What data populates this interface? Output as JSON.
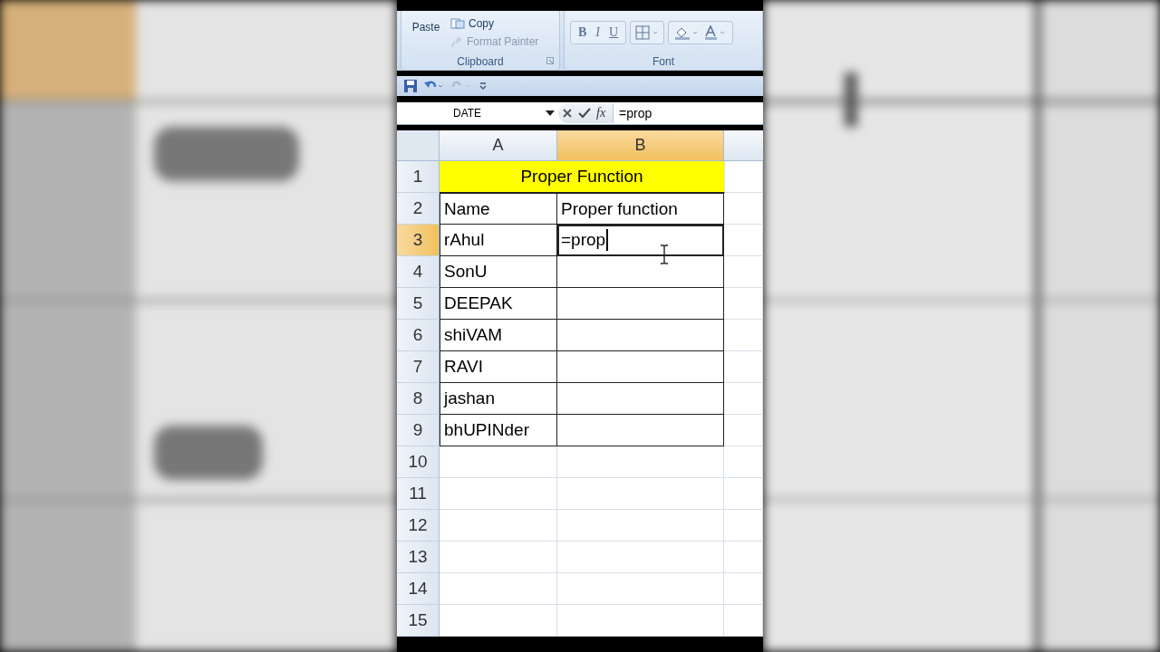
{
  "ribbon": {
    "clipboard": {
      "paste": "Paste",
      "copy": "Copy",
      "format_painter": "Format Painter",
      "label": "Clipboard"
    },
    "font": {
      "label": "Font",
      "buttons": [
        {
          "kind": "bold",
          "label": "B"
        },
        {
          "kind": "italic",
          "label": "I"
        },
        {
          "kind": "underline",
          "label": "U"
        }
      ]
    }
  },
  "formula_bar": {
    "name_box": "DATE",
    "fx": "fx",
    "formula": "=prop"
  },
  "columns": [
    {
      "label": "A",
      "selected": false
    },
    {
      "label": "B",
      "selected": true
    }
  ],
  "rows": [
    {
      "number": "1",
      "selected": false,
      "kind": "title",
      "title": "Proper Function"
    },
    {
      "number": "2",
      "selected": false,
      "kind": "table",
      "cells": [
        {
          "text": "Name",
          "editing": false
        },
        {
          "text": "Proper function",
          "editing": false
        }
      ]
    },
    {
      "number": "3",
      "selected": true,
      "kind": "table",
      "cells": [
        {
          "text": "rAhul",
          "editing": false
        },
        {
          "text": "=prop",
          "editing": true
        }
      ]
    },
    {
      "number": "4",
      "selected": false,
      "kind": "table",
      "cells": [
        {
          "text": "SonU",
          "editing": false
        },
        {
          "editing": false
        }
      ]
    },
    {
      "number": "5",
      "selected": false,
      "kind": "table",
      "cells": [
        {
          "text": "DEEPAK",
          "editing": false
        },
        {
          "editing": false
        }
      ]
    },
    {
      "number": "6",
      "selected": false,
      "kind": "table",
      "cells": [
        {
          "text": "shiVAM",
          "editing": false
        },
        {
          "editing": false
        }
      ]
    },
    {
      "number": "7",
      "selected": false,
      "kind": "table",
      "cells": [
        {
          "text": "RAVI",
          "editing": false
        },
        {
          "editing": false
        }
      ]
    },
    {
      "number": "8",
      "selected": false,
      "kind": "table",
      "cells": [
        {
          "text": "jashan",
          "editing": false
        },
        {
          "editing": false
        }
      ]
    },
    {
      "number": "9",
      "selected": false,
      "kind": "table",
      "cells": [
        {
          "text": "bhUPINder",
          "editing": false
        },
        {
          "editing": false
        }
      ]
    },
    {
      "number": "10",
      "selected": false,
      "kind": "blank"
    },
    {
      "number": "11",
      "selected": false,
      "kind": "blank"
    },
    {
      "number": "12",
      "selected": false,
      "kind": "blank"
    },
    {
      "number": "13",
      "selected": false,
      "kind": "blank"
    },
    {
      "number": "14",
      "selected": false,
      "kind": "blank"
    },
    {
      "number": "15",
      "selected": false,
      "kind": "blank"
    }
  ]
}
